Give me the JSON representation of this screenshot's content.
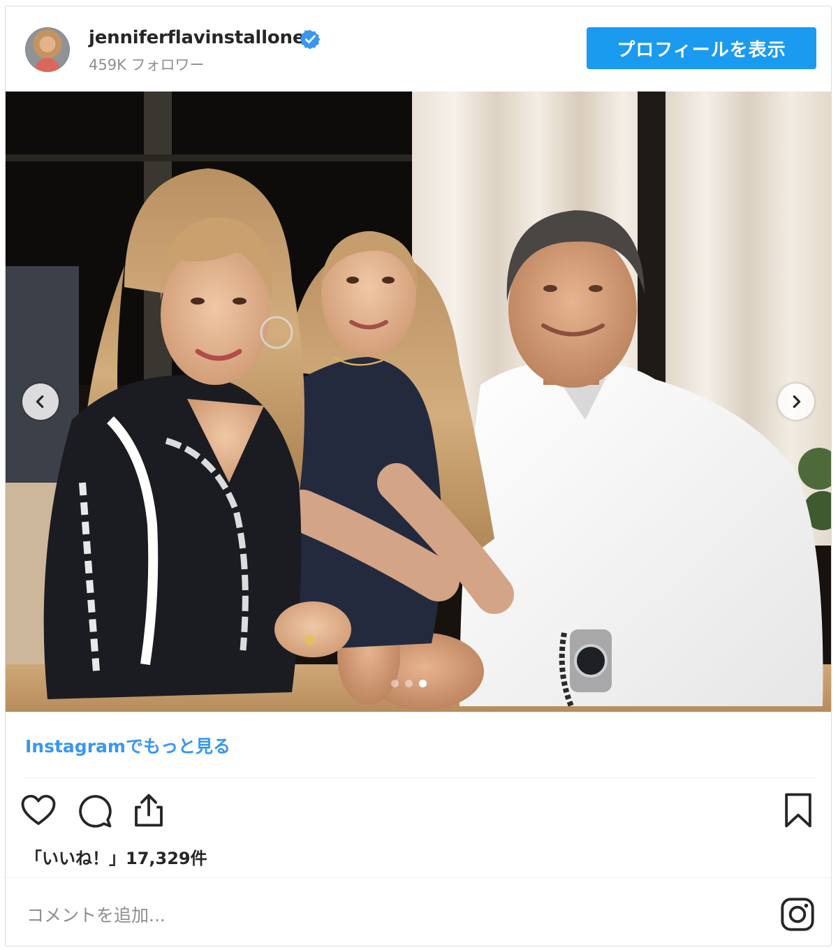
{
  "header": {
    "username": "jenniferflavinstallone",
    "followers": "459K フォロワー",
    "profile_button": "プロフィールを表示"
  },
  "photo": {
    "carousel_dots": 3,
    "active_dot": 3
  },
  "more_link": "Instagramでもっと見る",
  "likes_text": "「いいね！」17,329件",
  "comment": {
    "placeholder": "コメントを追加..."
  },
  "colors": {
    "accent": "#1a9bf0",
    "link": "#3897f0",
    "verified": "#3897f0",
    "muted": "#8e8e8e"
  },
  "icons": [
    "verified-badge-icon",
    "chevron-left-icon",
    "chevron-right-icon",
    "heart-icon",
    "comment-icon",
    "share-icon",
    "bookmark-icon",
    "instagram-logo-icon"
  ]
}
